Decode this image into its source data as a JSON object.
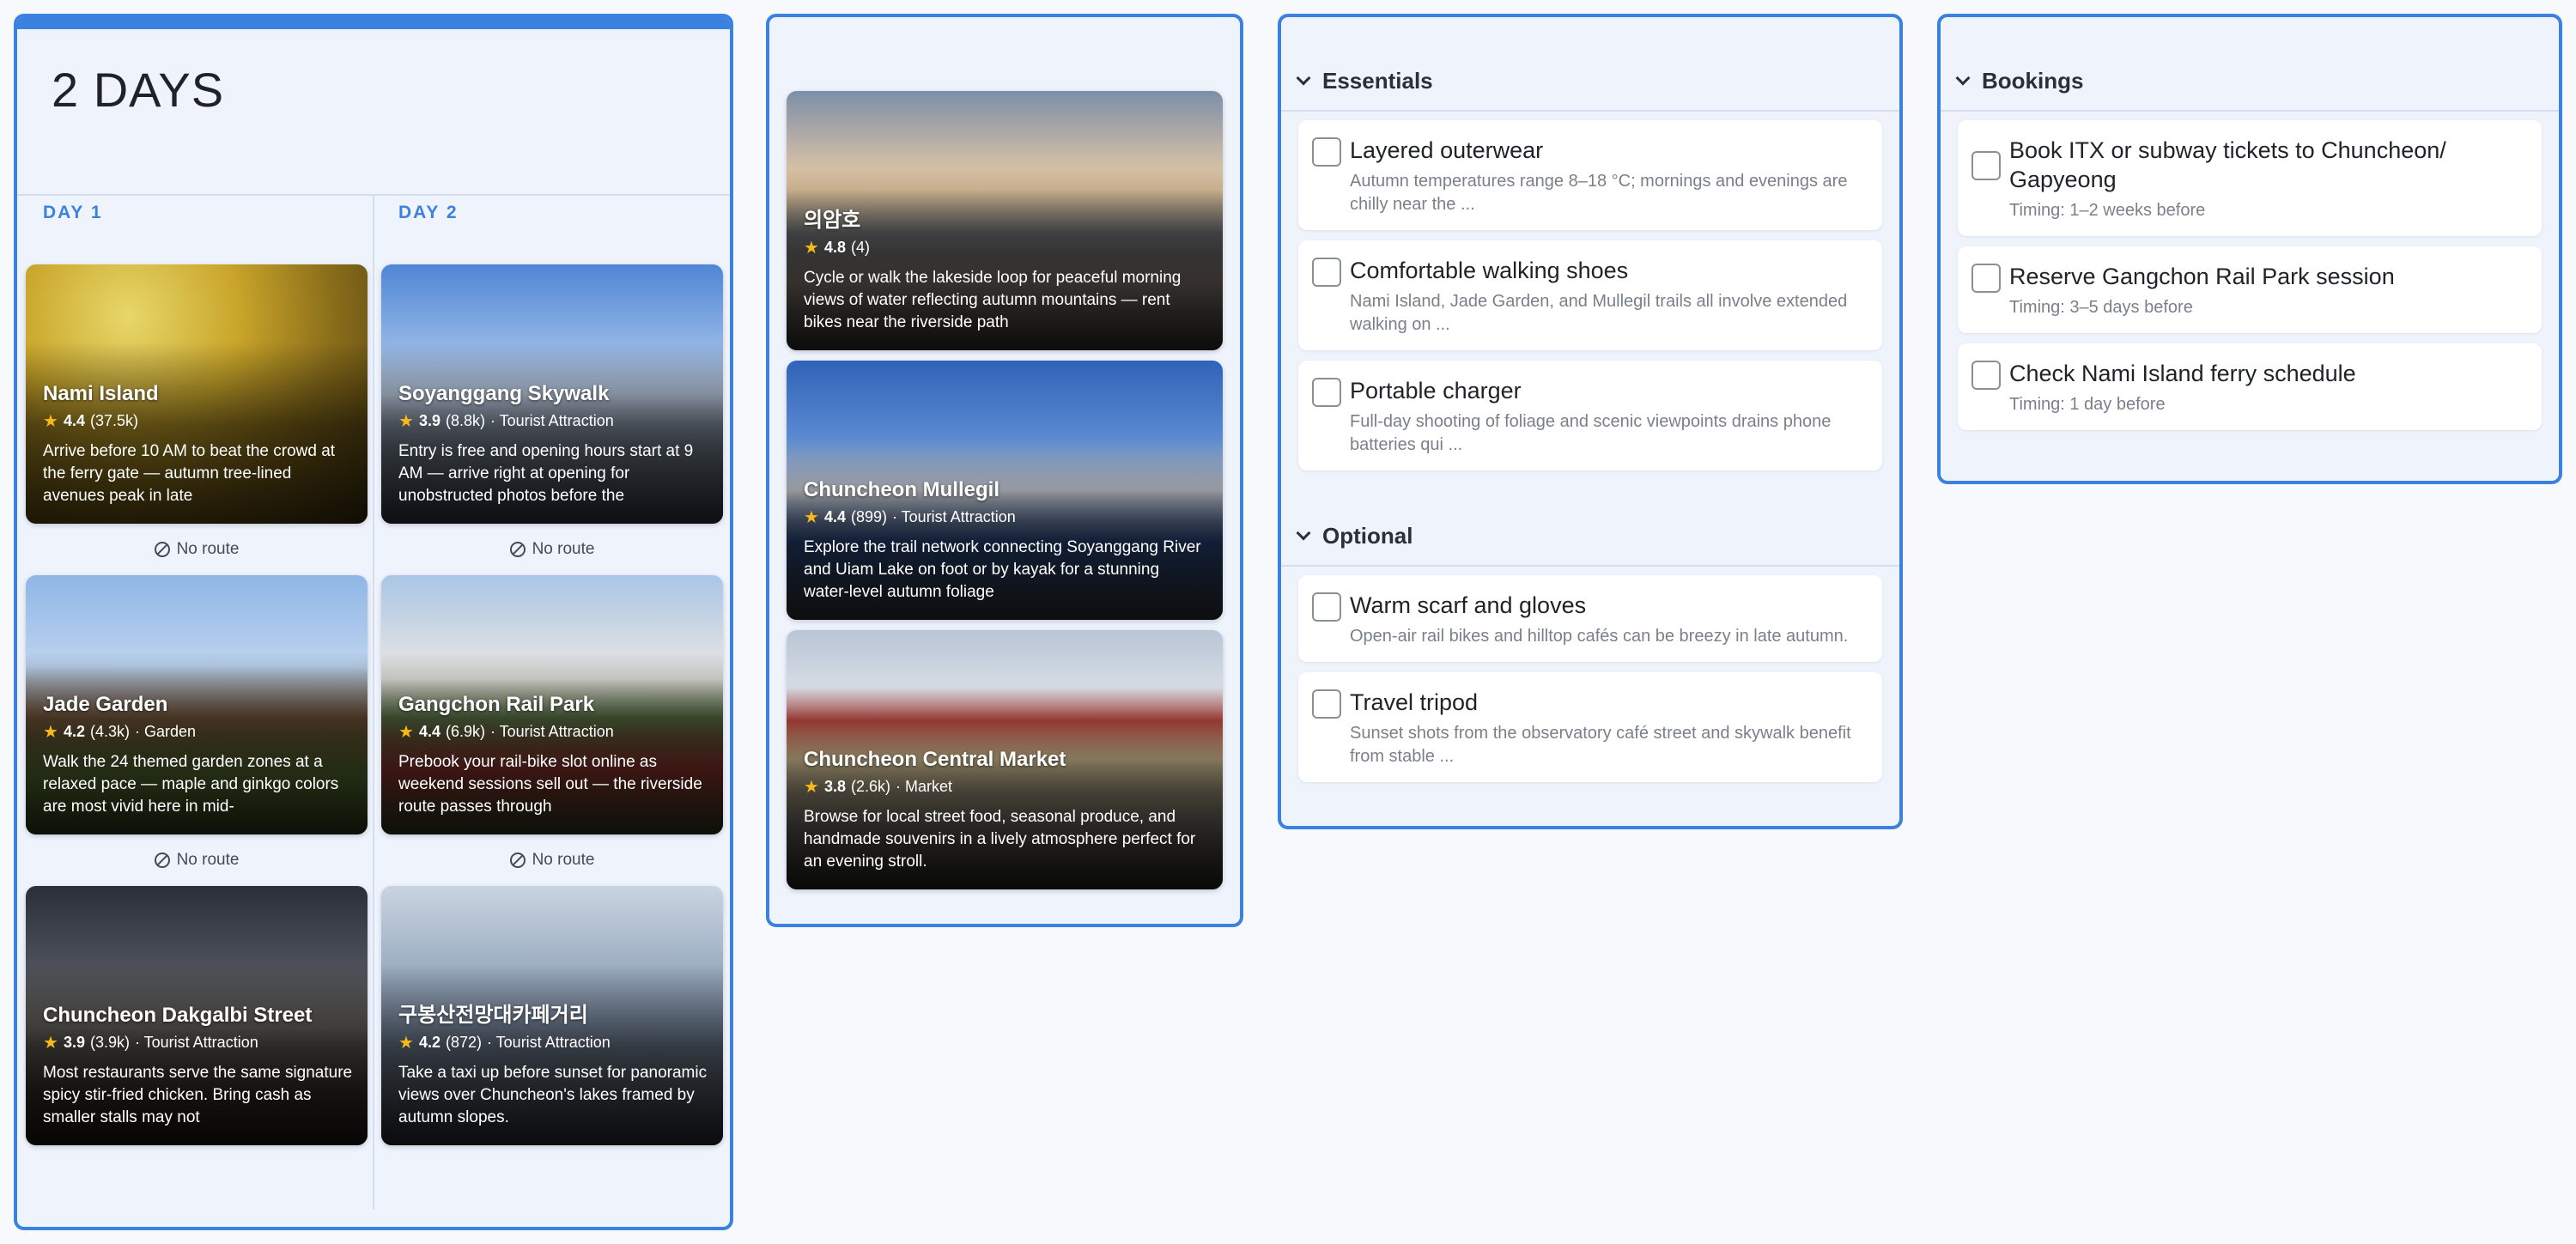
{
  "itinerary": {
    "title": "2 DAYS",
    "days": [
      {
        "label": "DAY 1",
        "places": [
          {
            "name": "Nami Island",
            "rating": "4.4",
            "reviews": "(37.5k)",
            "category": "",
            "description": "Arrive before 10 AM to beat the crowd at the ferry gate — autumn tree-lined avenues peak in late",
            "route": "No route"
          },
          {
            "name": "Jade Garden",
            "rating": "4.2",
            "reviews": "(4.3k)",
            "category": "· Garden",
            "description": "Walk the 24 themed garden zones at a relaxed pace — maple and ginkgo colors are most vivid here in mid-",
            "route": "No route"
          },
          {
            "name": "Chuncheon Dakgalbi Street",
            "rating": "3.9",
            "reviews": "(3.9k)",
            "category": "· Tourist Attraction",
            "description": "Most restaurants serve the same signature spicy stir-fried chicken. Bring cash as smaller stalls may not",
            "route": ""
          }
        ]
      },
      {
        "label": "DAY 2",
        "places": [
          {
            "name": "Soyanggang Skywalk",
            "rating": "3.9",
            "reviews": "(8.8k)",
            "category": "· Tourist Attraction",
            "description": "Entry is free and opening hours start at 9 AM — arrive right at opening for unobstructed photos before the",
            "route": "No route"
          },
          {
            "name": "Gangchon Rail Park",
            "rating": "4.4",
            "reviews": "(6.9k)",
            "category": "· Tourist Attraction",
            "description": "Prebook your rail-bike slot online as weekend sessions sell out — the riverside route passes through",
            "route": "No route"
          },
          {
            "name": "구봉산전망대카페거리",
            "rating": "4.2",
            "reviews": "(872)",
            "category": "· Tourist Attraction",
            "description": "Take a taxi up before sunset for panoramic views over Chuncheon's lakes framed by autumn slopes.",
            "route": ""
          }
        ]
      }
    ]
  },
  "unscheduled": [
    {
      "name": "의암호",
      "rating": "4.8",
      "reviews": "(4)",
      "category": "",
      "description": "Cycle or walk the lakeside loop for peaceful morning views of water reflecting autumn mountains — rent bikes near the riverside path"
    },
    {
      "name": "Chuncheon Mullegil",
      "rating": "4.4",
      "reviews": "(899)",
      "category": "· Tourist Attraction",
      "description": "Explore the trail network connecting Soyanggang River and Uiam Lake on foot or by kayak for a stunning water-level autumn foliage"
    },
    {
      "name": "Chuncheon Central Market",
      "rating": "3.8",
      "reviews": "(2.6k)",
      "category": "· Market",
      "description": "Browse for local street food, seasonal produce, and handmade souvenirs in a lively atmosphere perfect for an evening stroll."
    }
  ],
  "packing": {
    "essentials": {
      "title": "Essentials",
      "items": [
        {
          "label": "Layered outerwear",
          "note": "Autumn temperatures range 8–18 °C; mornings and evenings are chilly near the  ..."
        },
        {
          "label": "Comfortable walking shoes",
          "note": "Nami Island, Jade Garden, and Mullegil trails all involve extended walking on ..."
        },
        {
          "label": "Portable charger",
          "note": "Full-day shooting of foliage and scenic viewpoints drains phone batteries qui ..."
        }
      ]
    },
    "optional": {
      "title": "Optional",
      "items": [
        {
          "label": "Warm scarf and gloves",
          "note": "Open-air rail bikes and hilltop cafés can be breezy in late autumn."
        },
        {
          "label": "Travel tripod",
          "note": "Sunset shots from the observatory café street and skywalk benefit from stable ..."
        }
      ]
    }
  },
  "bookings": {
    "title": "Bookings",
    "items": [
      {
        "label": "Book ITX or subway tickets to Chuncheon/ Gapyeong",
        "note": "Timing: 1–2 weeks before"
      },
      {
        "label": "Reserve Gangchon Rail Park session",
        "note": "Timing: 3–5 days before"
      },
      {
        "label": "Check Nami Island ferry schedule",
        "note": "Timing: 1 day before"
      }
    ]
  },
  "colors": {
    "accent": "#3b82e0",
    "star": "#f6b91a",
    "panel": "#eef3fc"
  }
}
